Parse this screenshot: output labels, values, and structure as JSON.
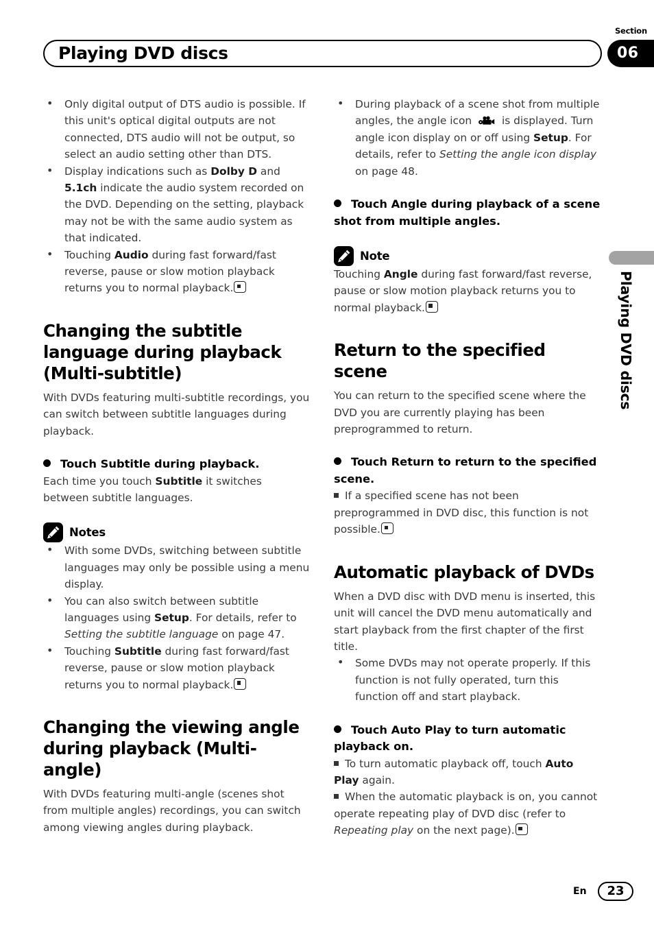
{
  "header": {
    "title": "Playing DVD discs",
    "section_label": "Section",
    "section_number": "06"
  },
  "side_tab": {
    "text": "Playing DVD discs",
    "color": "#a3a3a3"
  },
  "footer": {
    "language": "En",
    "page_number": "23"
  },
  "left_column": {
    "top_bullets": [
      {
        "plain_1": "Only digital output of DTS audio is possible. If this unit's optical digital outputs are not connected, DTS audio will not be output, so select an audio setting other than DTS."
      },
      {
        "pre": "Display indications such as ",
        "bold_1": "Dolby D",
        "mid": " and ",
        "bold_2": "5.1ch",
        "post": " indicate the audio system recorded on the DVD. Depending on the setting, playback may not be with the same audio system as that indicated."
      },
      {
        "pre": "Touching ",
        "bold_1": "Audio",
        "post": " during fast forward/fast reverse, pause or slow motion playback returns you to normal playback."
      }
    ],
    "subtitle_section": {
      "heading": "Changing the subtitle language during playback (Multi-subtitle)",
      "intro": "With DVDs featuring multi-subtitle recordings, you can switch between subtitle languages during playback.",
      "instruction": "Touch Subtitle during playback.",
      "detail_pre": "Each time you touch ",
      "detail_bold": "Subtitle",
      "detail_post": " it switches between subtitle languages.",
      "notes_label": "Notes",
      "notes_icon": "pencil-icon",
      "notes": [
        {
          "plain_1": "With some DVDs, switching between subtitle languages may only be possible using a menu display."
        },
        {
          "pre": "You can also switch between subtitle languages using ",
          "bold_1": "Setup",
          "mid": ". For details, refer to ",
          "italic_1": "Setting the subtitle language",
          "post": " on page 47."
        },
        {
          "pre": "Touching ",
          "bold_1": "Subtitle",
          "post": " during fast forward/fast reverse, pause or slow motion playback returns you to normal playback."
        }
      ]
    },
    "angle_section": {
      "heading": "Changing the viewing angle during playback (Multi-angle)",
      "intro": "With DVDs featuring multi-angle (scenes shot from multiple angles) recordings, you can switch among viewing angles during playback."
    }
  },
  "right_column": {
    "angle_bullet": {
      "pre": "During playback of a scene shot from multiple angles, the angle icon ",
      "icon": "movie-camera-icon",
      "mid": " is displayed. Turn angle icon display on or off using ",
      "bold_1": "Setup",
      "mid_2": ". For details, refer to ",
      "italic_1": "Setting the angle icon display",
      "post": " on page 48."
    },
    "angle_instruction": "Touch Angle during playback of a scene shot from multiple angles.",
    "note_label": "Note",
    "note_icon": "pencil-icon",
    "note_body": {
      "pre": "Touching ",
      "bold_1": "Angle",
      "post": " during fast forward/fast reverse, pause or slow motion playback returns you to normal playback."
    },
    "return_section": {
      "heading": "Return to the specified scene",
      "intro": "You can return to the specified scene where the DVD you are currently playing has been preprogrammed to return.",
      "instruction": "Touch Return to return to the specified scene.",
      "sub_item": "If a specified scene has not been preprogrammed in DVD disc, this function is not possible."
    },
    "auto_section": {
      "heading": "Automatic playback of DVDs",
      "intro": "When a DVD disc with DVD menu is inserted, this unit will cancel the DVD menu automatically and start playback from the first chapter of the first title.",
      "bullet": "Some DVDs may not operate properly. If this function is not fully operated, turn this function off and start playback.",
      "instruction": "Touch Auto Play to turn automatic playback on.",
      "sub_items": [
        {
          "pre": "To turn automatic playback off, touch ",
          "bold_1": "Auto Play",
          "post": " again."
        },
        {
          "pre": "When the automatic playback is on, you cannot operate repeating play of DVD disc (refer to ",
          "italic_1": "Repeating play",
          "post": " on the next page)."
        }
      ]
    }
  }
}
